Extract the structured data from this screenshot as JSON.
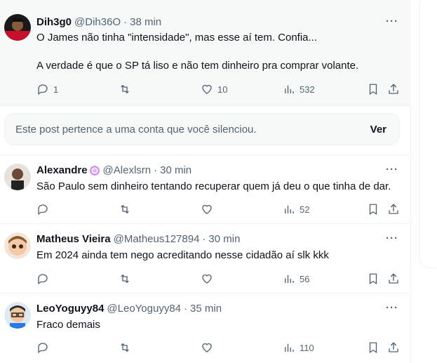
{
  "tweets": [
    {
      "name": "Dih3g0",
      "handle": "@Dih36O",
      "time": "38 min",
      "text_line1": "O James não tinha \"intensidade\", mas esse aí tem. Confia...",
      "text_line2": "A verdade é que o SP tá liso e não tem dinheiro pra comprar volante.",
      "replies": "1",
      "retweets": "",
      "likes": "10",
      "views": "532"
    },
    {
      "name": "Alexandre",
      "handle": "@Alexlsrn",
      "time": "30 min",
      "text_line1": "São Paulo sem dinheiro tentando recuperar quem já deu o que tinha de dar.",
      "replies": "",
      "retweets": "",
      "likes": "",
      "views": "52"
    },
    {
      "name": "Matheus Vieira",
      "handle": "@Matheus127894",
      "time": "30 min",
      "text_line1": "Em 2024 ainda tem nego acreditando nesse cidadão aí slk kkk",
      "replies": "",
      "retweets": "",
      "likes": "",
      "views": "56"
    },
    {
      "name": "LeoYoguyy84",
      "handle": "@LeoYoguyy84",
      "time": "35 min",
      "text_line1": "Fraco demais",
      "replies": "",
      "retweets": "",
      "likes": "",
      "views": "110"
    }
  ],
  "muted": {
    "message": "Este post pertence a uma conta que você silenciou.",
    "action": "Ver"
  },
  "ui": {
    "separator": "·",
    "more": "···"
  },
  "colors": {
    "text": "#0f1419",
    "secondary": "#536471",
    "border": "#eff3f4",
    "highlight_bg": "#f7f9f9"
  }
}
